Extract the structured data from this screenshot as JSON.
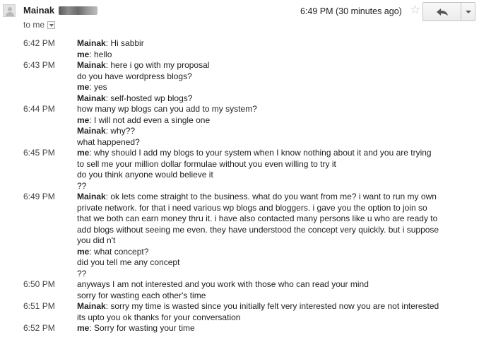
{
  "header": {
    "sender": "Mainak",
    "to_label": "to me",
    "timestamp": "6:49 PM (30 minutes ago)",
    "star_icon": "star-icon",
    "reply_icon": "reply-arrow-icon",
    "more_icon": "chevron-down-icon"
  },
  "messages": [
    {
      "time": "6:42 PM",
      "lines": [
        {
          "who": "Mainak",
          "text": ": Hi sabbir"
        },
        {
          "who": "me",
          "text": ": hello"
        }
      ]
    },
    {
      "time": "6:43 PM",
      "lines": [
        {
          "who": "Mainak",
          "text": ": here i go with my proposal"
        },
        {
          "who": "",
          "text": "do you have wordpress blogs?"
        },
        {
          "who": "me",
          "text": ": yes"
        },
        {
          "who": "Mainak",
          "text": ": self-hosted wp blogs?"
        }
      ]
    },
    {
      "time": "6:44 PM",
      "lines": [
        {
          "who": "",
          "text": "how many wp blogs can you add to my system?"
        },
        {
          "who": "me",
          "text": ": I will not add even a single one"
        },
        {
          "who": "Mainak",
          "text": ": why??"
        },
        {
          "who": "",
          "text": "what happened?"
        }
      ]
    },
    {
      "time": "6:45 PM",
      "lines": [
        {
          "who": "me",
          "text": ": why should I add my blogs to your system when I know nothing about it and you are trying"
        },
        {
          "who": "",
          "text": "to sell me your million dollar formulae without you even willing to try it"
        },
        {
          "who": "",
          "text": "do you think anyone would believe it"
        },
        {
          "who": "",
          "text": "??"
        }
      ]
    },
    {
      "time": "6:49 PM",
      "lines": [
        {
          "who": "Mainak",
          "text": ": ok lets come straight to the business. what do you want from me? i want to run my own"
        },
        {
          "who": "",
          "text": "private network. for that i need various wp blogs and bloggers. i gave you the option to join so"
        },
        {
          "who": "",
          "text": "that we both can earn money thru it. i have also contacted many persons like u who are ready to"
        },
        {
          "who": "",
          "text": "add blogs without seeing me even. they have understood the concept very quickly. but i suppose"
        },
        {
          "who": "",
          "text": "you did n't"
        },
        {
          "who": "me",
          "text": ": what concept?"
        },
        {
          "who": "",
          "text": "did you tell me any concept"
        },
        {
          "who": "",
          "text": "??"
        }
      ]
    },
    {
      "time": "6:50 PM",
      "lines": [
        {
          "who": "",
          "text": "anyways I am not interested and you work with those who can read your mind"
        },
        {
          "who": "",
          "text": "sorry for wasting each other's time"
        }
      ]
    },
    {
      "time": "6:51 PM",
      "lines": [
        {
          "who": "Mainak",
          "text": ": sorry my time is wasted since you initially felt very interested now you are not interested"
        },
        {
          "who": "",
          "text": "its upto you ok thanks for your conversation"
        }
      ]
    },
    {
      "time": "6:52 PM",
      "lines": [
        {
          "who": "me",
          "text": ": Sorry for wasting your time"
        }
      ]
    }
  ]
}
